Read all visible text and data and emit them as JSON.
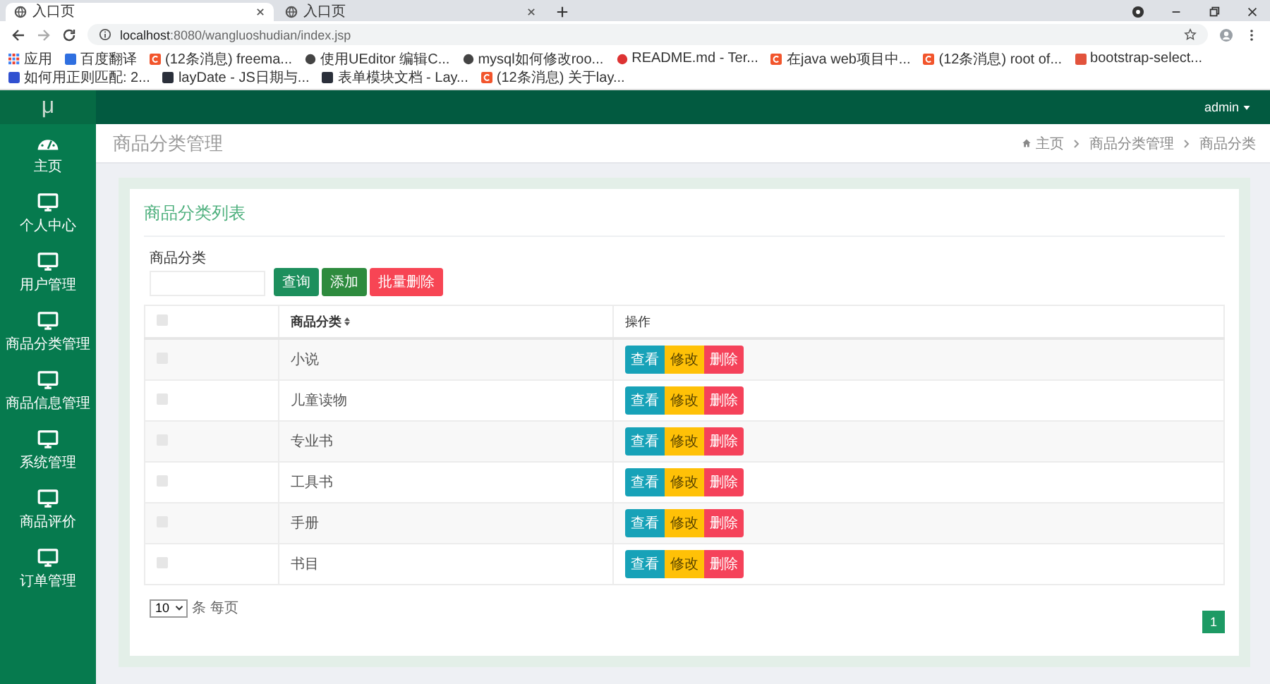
{
  "browser": {
    "tabs": [
      {
        "title": "入口页",
        "selected": true
      },
      {
        "title": "入口页",
        "selected": false
      }
    ],
    "address": {
      "host": "localhost",
      "path": ":8080/wangluoshudian/index.jsp"
    },
    "bookmarks": [
      {
        "label": "应用",
        "kind": "grid"
      },
      {
        "label": "百度翻译",
        "kind": "translate"
      },
      {
        "label": "(12条消息) freema...",
        "kind": "csdn"
      },
      {
        "label": "使用UEditor 编辑C...",
        "kind": "octo"
      },
      {
        "label": "mysql如何修改roo...",
        "kind": "octo"
      },
      {
        "label": "README.md - Ter...",
        "kind": "circle"
      },
      {
        "label": "在java web项目中...",
        "kind": "csdn"
      },
      {
        "label": "(12条消息) root of...",
        "kind": "csdn"
      },
      {
        "label": "bootstrap-select...",
        "kind": "square"
      },
      {
        "label": "如何用正则匹配: 2...",
        "kind": "paw"
      },
      {
        "label": "layDate - JS日期与...",
        "kind": "layui"
      },
      {
        "label": "表单模块文档 - Lay...",
        "kind": "layui"
      },
      {
        "label": "(12条消息) 关于lay...",
        "kind": "csdn"
      }
    ]
  },
  "app": {
    "logo": "μ",
    "user": "admin",
    "sidebar": [
      {
        "label": "主页",
        "kind": "dashboard"
      },
      {
        "label": "个人中心",
        "kind": "monitor"
      },
      {
        "label": "用户管理",
        "kind": "monitor"
      },
      {
        "label": "商品分类管理",
        "kind": "monitor"
      },
      {
        "label": "商品信息管理",
        "kind": "monitor"
      },
      {
        "label": "系统管理",
        "kind": "monitor"
      },
      {
        "label": "商品评价",
        "kind": "monitor"
      },
      {
        "label": "订单管理",
        "kind": "monitor"
      }
    ],
    "page_title": "商品分类管理",
    "breadcrumb": [
      "主页",
      "商品分类管理",
      "商品分类"
    ]
  },
  "panel": {
    "title": "商品分类列表",
    "search_label": "商品分类",
    "buttons": [
      {
        "label": "查询",
        "kind": "search"
      },
      {
        "label": "添加",
        "kind": "add"
      },
      {
        "label": "批量删除",
        "kind": "delete"
      }
    ],
    "table": {
      "columns": [
        {
          "kind": "check",
          "checked": false
        },
        {
          "label": "商品分类",
          "kind": "sortable"
        },
        {
          "label": "操作",
          "kind": "text"
        }
      ],
      "rows": [
        {
          "checked": false,
          "name": "小说",
          "actions": [
            {
              "label": "查看",
              "kind": "view"
            },
            {
              "label": "修改",
              "kind": "edit"
            },
            {
              "label": "删除",
              "kind": "delete"
            }
          ]
        },
        {
          "checked": false,
          "name": "儿童读物",
          "actions": [
            {
              "label": "查看",
              "kind": "view"
            },
            {
              "label": "修改",
              "kind": "edit"
            },
            {
              "label": "删除",
              "kind": "delete"
            }
          ]
        },
        {
          "checked": false,
          "name": "专业书",
          "actions": [
            {
              "label": "查看",
              "kind": "view"
            },
            {
              "label": "修改",
              "kind": "edit"
            },
            {
              "label": "删除",
              "kind": "delete"
            }
          ]
        },
        {
          "checked": false,
          "name": "工具书",
          "actions": [
            {
              "label": "查看",
              "kind": "view"
            },
            {
              "label": "修改",
              "kind": "edit"
            },
            {
              "label": "删除",
              "kind": "delete"
            }
          ]
        },
        {
          "checked": false,
          "name": "手册",
          "actions": [
            {
              "label": "查看",
              "kind": "view"
            },
            {
              "label": "修改",
              "kind": "edit"
            },
            {
              "label": "删除",
              "kind": "delete"
            }
          ]
        },
        {
          "checked": false,
          "name": "书目",
          "actions": [
            {
              "label": "查看",
              "kind": "view"
            },
            {
              "label": "修改",
              "kind": "edit"
            },
            {
              "label": "删除",
              "kind": "delete"
            }
          ]
        }
      ]
    },
    "page_size": "10",
    "page_size_unit": "条 每页",
    "pages": [
      {
        "label": "1",
        "selected": true
      }
    ]
  }
}
